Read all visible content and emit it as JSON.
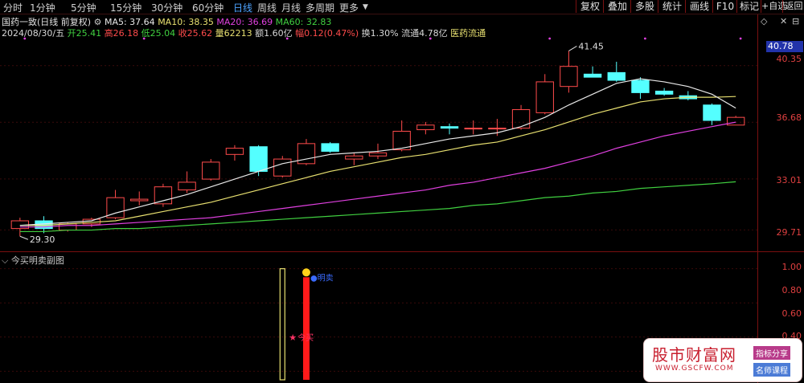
{
  "toolbar": {
    "periods": [
      "分时",
      "1分钟",
      "5分钟",
      "15分钟",
      "30分钟",
      "60分钟",
      "日线",
      "周线",
      "月线",
      "多周期",
      "更多"
    ],
    "active_period": "日线",
    "buttons": [
      "复权",
      "叠加",
      "多股",
      "统计",
      "画线",
      "F10",
      "标记",
      "+自选",
      "返回"
    ]
  },
  "header": {
    "stock": "国药一致(日线 前复权)",
    "ma5_label": "MA5: 37.64",
    "ma10_label": "MA10: 38.35",
    "ma20_label": "MA20: 36.69",
    "ma60_label": "MA60: 32.83"
  },
  "quote": {
    "date": "2024/08/30/五",
    "open": "开25.41",
    "high": "高26.18",
    "low": "低25.04",
    "close": "收25.62",
    "volume": "量62213",
    "amount": "额1.60亿",
    "change": "幅0.12(0.47%)",
    "turnover": "换1.30%",
    "float": "流通4.78亿",
    "sector": "医药流通"
  },
  "price_axis": {
    "labels": [
      "40.35",
      "36.68",
      "33.01",
      "29.71"
    ],
    "current_price": "40.78",
    "max_marker": "41.45",
    "min_marker": "29.30"
  },
  "sub_chart": {
    "title": "今买明卖副图",
    "axis_labels": [
      "1.00",
      "0.80",
      "0.60",
      "0.40"
    ],
    "buy_label": "今买",
    "sell_label": "明卖"
  },
  "watermark": {
    "title": "股市财富网",
    "url": "WWW.GSCFW.COM",
    "tag1": "指标分享",
    "tag2": "名师课程"
  },
  "colors": {
    "up": "#ff4b4b",
    "down": "#54ffff",
    "ma5": "#e8e8e8",
    "ma10": "#e8e070",
    "ma20": "#e040e0",
    "ma60": "#40d040",
    "axis": "#e04040"
  },
  "chart_data": {
    "type": "candlestick",
    "ohlc": [
      [
        29.8,
        30.5,
        29.3,
        30.3
      ],
      [
        30.3,
        30.6,
        29.5,
        29.8
      ],
      [
        29.7,
        30.2,
        29.6,
        30.1
      ],
      [
        30.1,
        30.5,
        29.9,
        30.4
      ],
      [
        30.5,
        32.3,
        30.4,
        31.8
      ],
      [
        31.6,
        32.2,
        31.3,
        31.7
      ],
      [
        31.4,
        32.7,
        31.2,
        32.5
      ],
      [
        32.3,
        33.5,
        32.1,
        32.8
      ],
      [
        33.0,
        34.3,
        32.9,
        34.1
      ],
      [
        34.6,
        35.2,
        34.2,
        35.0
      ],
      [
        35.1,
        35.2,
        33.2,
        33.5
      ],
      [
        33.2,
        34.5,
        33.1,
        34.3
      ],
      [
        34.0,
        35.6,
        33.9,
        35.3
      ],
      [
        35.3,
        35.4,
        34.7,
        34.8
      ],
      [
        34.3,
        34.7,
        33.9,
        34.5
      ],
      [
        34.5,
        35.3,
        34.3,
        34.7
      ],
      [
        34.9,
        36.8,
        34.8,
        36.1
      ],
      [
        36.2,
        36.7,
        35.9,
        36.5
      ],
      [
        36.4,
        36.6,
        35.9,
        36.3
      ],
      [
        36.3,
        36.8,
        35.9,
        36.3
      ],
      [
        36.3,
        36.9,
        35.8,
        36.3
      ],
      [
        36.3,
        37.8,
        36.2,
        37.5
      ],
      [
        37.3,
        39.8,
        37.2,
        39.3
      ],
      [
        39.0,
        41.3,
        38.6,
        40.3
      ],
      [
        39.8,
        40.3,
        39.6,
        39.6
      ],
      [
        39.9,
        40.6,
        39.3,
        39.4
      ],
      [
        39.4,
        39.6,
        38.2,
        38.6
      ],
      [
        38.7,
        38.9,
        38.4,
        38.5
      ],
      [
        38.4,
        38.7,
        38.1,
        38.2
      ],
      [
        37.8,
        37.9,
        36.5,
        36.8
      ],
      [
        36.5,
        37.1,
        36.5,
        37.0
      ]
    ],
    "ma5": [
      30.0,
      30.1,
      30.2,
      30.3,
      30.8,
      31.2,
      31.6,
      32.0,
      32.5,
      33.0,
      33.5,
      34.0,
      34.3,
      34.6,
      34.7,
      34.8,
      35.0,
      35.3,
      35.6,
      35.8,
      36.0,
      36.4,
      37.0,
      37.8,
      38.5,
      39.2,
      39.5,
      39.3,
      39.0,
      38.5,
      37.6
    ],
    "ma10": [
      30.0,
      30.0,
      30.1,
      30.2,
      30.3,
      30.6,
      30.9,
      31.2,
      31.5,
      31.9,
      32.3,
      32.7,
      33.1,
      33.5,
      33.8,
      34.1,
      34.4,
      34.6,
      34.9,
      35.2,
      35.4,
      35.8,
      36.2,
      36.7,
      37.2,
      37.6,
      38.0,
      38.2,
      38.3,
      38.3,
      38.35
    ],
    "ma20": [
      29.9,
      29.9,
      30.0,
      30.0,
      30.1,
      30.2,
      30.3,
      30.4,
      30.5,
      30.7,
      30.9,
      31.1,
      31.3,
      31.5,
      31.7,
      31.9,
      32.1,
      32.3,
      32.6,
      32.8,
      33.1,
      33.4,
      33.7,
      34.1,
      34.5,
      35.0,
      35.4,
      35.8,
      36.1,
      36.4,
      36.69
    ],
    "ma60": [
      29.6,
      29.6,
      29.7,
      29.7,
      29.8,
      29.8,
      29.9,
      30.0,
      30.1,
      30.2,
      30.3,
      30.4,
      30.5,
      30.6,
      30.7,
      30.8,
      30.9,
      31.0,
      31.1,
      31.3,
      31.4,
      31.6,
      31.8,
      31.9,
      32.1,
      32.2,
      32.4,
      32.5,
      32.6,
      32.7,
      32.83
    ],
    "ylim": [
      29.0,
      42.0
    ],
    "sub_chart": {
      "ylim": [
        0.35,
        1.05
      ],
      "buy_bar": {
        "index": 11,
        "value": 1.0,
        "style": "hollow-yellow"
      },
      "sell_bar": {
        "index": 12,
        "value": 0.95,
        "style": "solid-red"
      }
    }
  }
}
